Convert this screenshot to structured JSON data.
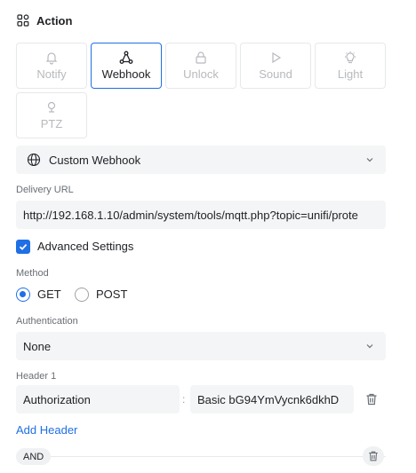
{
  "header": {
    "title": "Action",
    "icon": "grid-icon"
  },
  "tiles": [
    {
      "label": "Notify",
      "icon": "bell-icon",
      "active": false
    },
    {
      "label": "Webhook",
      "icon": "webhook-icon",
      "active": true
    },
    {
      "label": "Unlock",
      "icon": "lock-icon",
      "active": false
    },
    {
      "label": "Sound",
      "icon": "play-icon",
      "active": false
    },
    {
      "label": "Light",
      "icon": "lightbulb-icon",
      "active": false
    },
    {
      "label": "PTZ",
      "icon": "ptz-camera-icon",
      "active": false
    }
  ],
  "webhook_type": {
    "value": "Custom Webhook",
    "icon": "globe-icon"
  },
  "delivery": {
    "label": "Delivery URL",
    "value": "http://192.168.1.10/admin/system/tools/mqtt.php?topic=unifi/prote"
  },
  "advanced": {
    "label": "Advanced Settings",
    "checked": true
  },
  "method": {
    "label": "Method",
    "options": [
      "GET",
      "POST"
    ],
    "selected": "GET"
  },
  "authentication": {
    "label": "Authentication",
    "value": "None"
  },
  "header1": {
    "label": "Header 1",
    "key": "Authorization",
    "separator": ":",
    "value": "Basic bG94YmVycnk6dkhD"
  },
  "add_header": "Add Header",
  "condition": {
    "label": "AND"
  },
  "colors": {
    "accent": "#1f6fe5",
    "field_bg": "#f4f5f6",
    "border": "#e7e8ea",
    "muted": "#b7b9bd"
  }
}
